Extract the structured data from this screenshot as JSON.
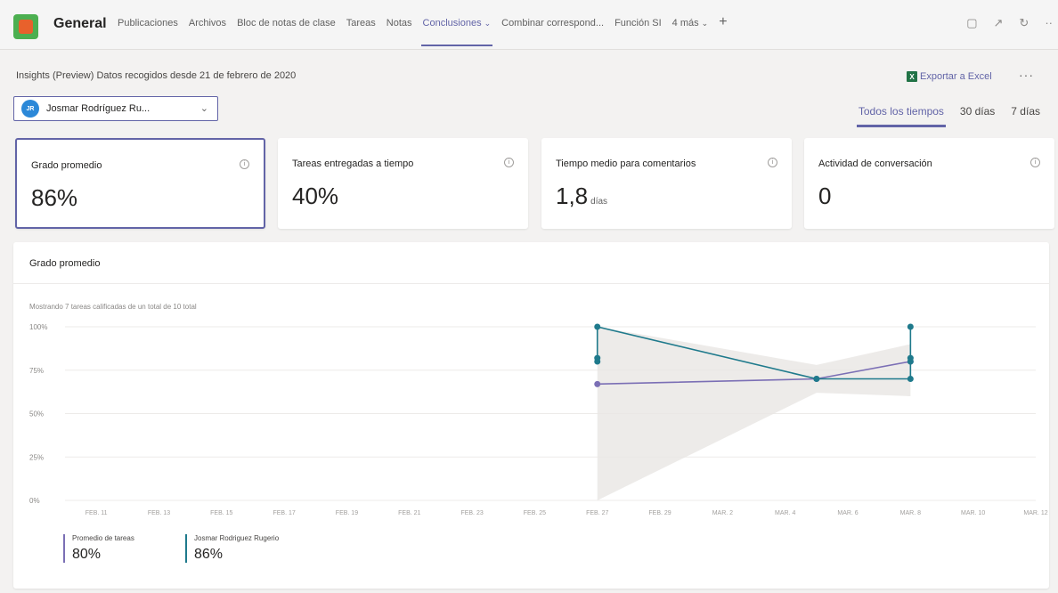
{
  "header": {
    "channel": "General",
    "tabs": [
      "Publicaciones",
      "Archivos",
      "Bloc de notas de clase",
      "Tareas",
      "Notas",
      "Conclusiones",
      "Combinar correspond...",
      "Función SI",
      "4 más"
    ],
    "active_tab": "Conclusiones",
    "icons": [
      "chat-icon",
      "expand-icon",
      "refresh-icon",
      "more-icon"
    ]
  },
  "insights": {
    "title": "Insights (Preview) Datos recogidos desde 21 de febrero de 2020",
    "export_label": "Exportar a Excel",
    "student": {
      "initials": "JR",
      "name": "Josmar Rodríguez Ru..."
    },
    "range_tabs": [
      "Todos los tiempos",
      "30 días",
      "7 días"
    ],
    "active_range": "Todos los tiempos"
  },
  "cards": [
    {
      "title": "Grado promedio",
      "value": "86%",
      "unit": ""
    },
    {
      "title": "Tareas entregadas a tiempo",
      "value": "40%",
      "unit": ""
    },
    {
      "title": "Tiempo medio para comentarios",
      "value": "1,8",
      "unit": "días"
    },
    {
      "title": "Actividad de conversación",
      "value": "0",
      "unit": ""
    }
  ],
  "chart_panel": {
    "heading": "Grado promedio",
    "subtitle": "Mostrando 7 tareas calificadas de un total de 10 total"
  },
  "colors": {
    "accent": "#6264a7",
    "series_average": "#7b6fb5",
    "series_student": "#1f7a8c",
    "band": "#e9e6e3"
  },
  "chart_data": {
    "type": "line",
    "title": "Grado promedio",
    "subtitle": "Mostrando 7 tareas calificadas de un total de 10 total",
    "x_tick_labels": [
      "FEB. 11",
      "FEB. 13",
      "FEB. 15",
      "FEB. 17",
      "FEB. 19",
      "FEB. 21",
      "FEB. 23",
      "FEB. 25",
      "FEB. 27",
      "FEB. 29",
      "MAR. 2",
      "MAR. 4",
      "MAR. 6",
      "MAR. 8",
      "MAR. 10",
      "MAR. 12"
    ],
    "xlim": [
      "2020-02-10",
      "2020-03-12"
    ],
    "y_tick_labels": [
      "100%",
      "75%",
      "50%",
      "25%",
      "0%"
    ],
    "ylim": [
      0,
      100
    ],
    "grid": true,
    "band": {
      "upper": [
        {
          "x": "2020-02-27",
          "y": 100
        },
        {
          "x": "2020-03-05",
          "y": 78
        },
        {
          "x": "2020-03-08",
          "y": 90
        }
      ],
      "lower": [
        {
          "x": "2020-02-27",
          "y": 0
        },
        {
          "x": "2020-03-05",
          "y": 62
        },
        {
          "x": "2020-03-08",
          "y": 60
        }
      ]
    },
    "series": [
      {
        "name": "Promedio de tareas",
        "color": "#7b6fb5",
        "summary": "80%",
        "points": [
          {
            "x": "2020-02-27",
            "y": 67
          },
          {
            "x": "2020-03-05",
            "y": 70
          },
          {
            "x": "2020-03-08",
            "y": 80
          }
        ]
      },
      {
        "name": "Josmar Rodriguez Rugerio",
        "color": "#1f7a8c",
        "summary": "86%",
        "points": [
          {
            "x": "2020-02-27",
            "y": 80
          },
          {
            "x": "2020-02-27",
            "y": 82
          },
          {
            "x": "2020-02-27",
            "y": 100
          },
          {
            "x": "2020-03-05",
            "y": 70
          },
          {
            "x": "2020-03-08",
            "y": 70
          },
          {
            "x": "2020-03-08",
            "y": 80
          },
          {
            "x": "2020-03-08",
            "y": 82
          },
          {
            "x": "2020-03-08",
            "y": 100
          }
        ]
      }
    ],
    "legend": "bottom-left"
  }
}
